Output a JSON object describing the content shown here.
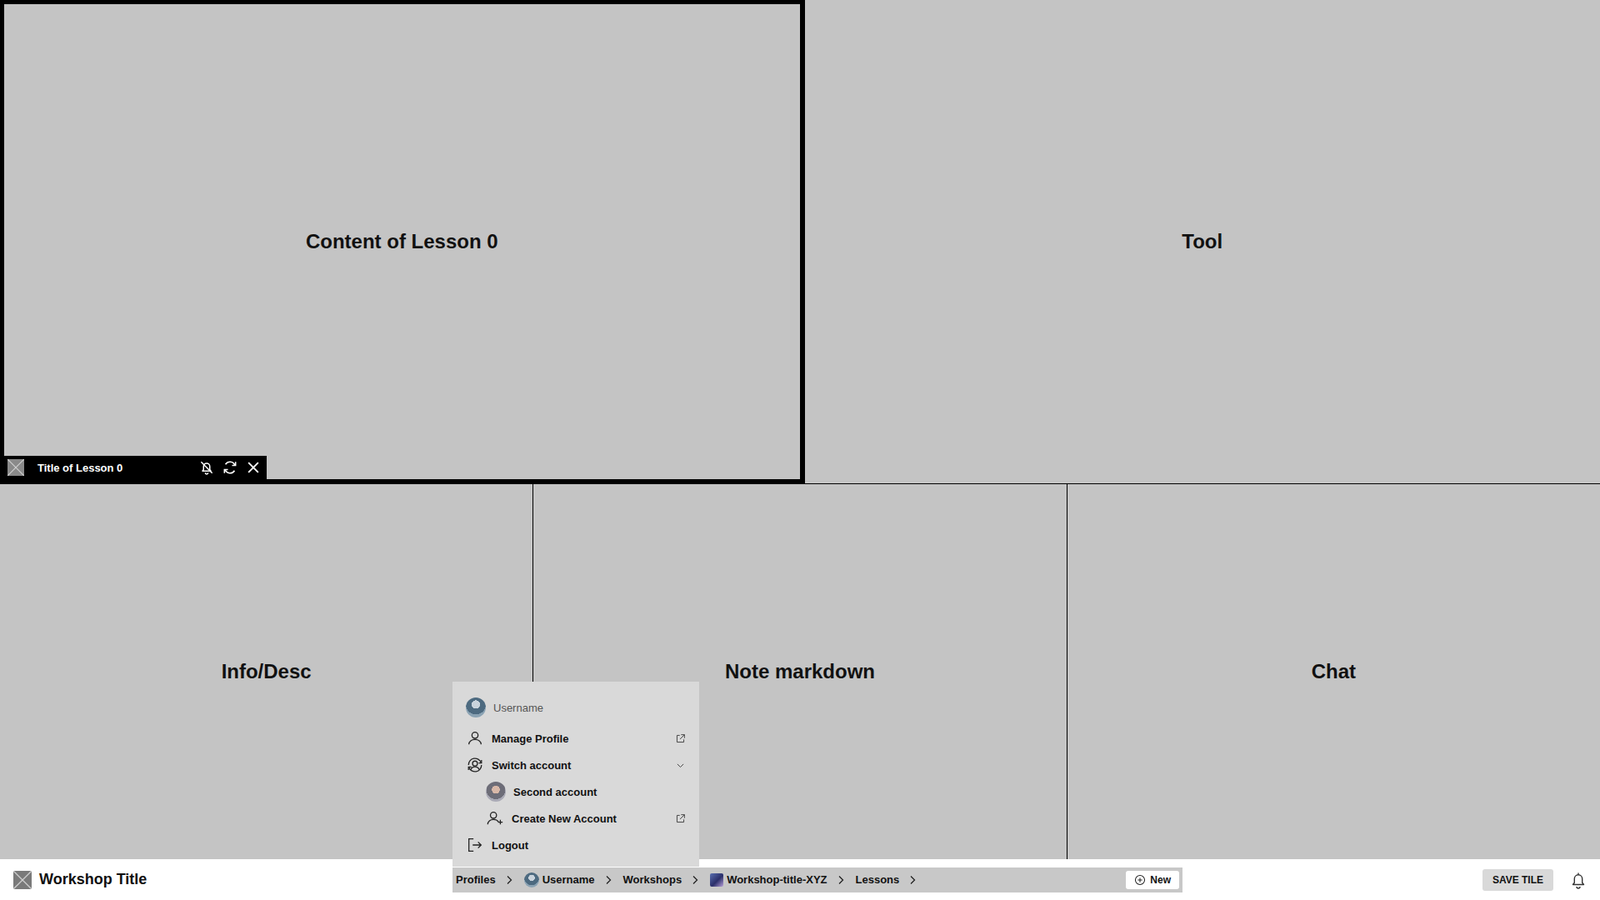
{
  "tile_rows": [
    {
      "tiles": [
        {
          "label": "Content of Lesson 0",
          "focused": true
        },
        {
          "label": "Tool",
          "focused": false
        }
      ]
    },
    {
      "tiles": [
        {
          "label": "Info/Desc",
          "focused": false
        },
        {
          "label": "Note markdown",
          "focused": false
        },
        {
          "label": "Chat",
          "focused": false
        }
      ]
    }
  ],
  "tile_bar": {
    "title": "Title of Lesson 0",
    "notifications_muted": true
  },
  "app_bar": {
    "title": "Workshop Title",
    "breadcrumbs": [
      {
        "label": "Profiles",
        "kind": "text"
      },
      {
        "label": "Username",
        "kind": "user"
      },
      {
        "label": "Workshops",
        "kind": "text"
      },
      {
        "label": "Workshop-title-XYZ",
        "kind": "workshop"
      },
      {
        "label": "Lessons",
        "kind": "text"
      }
    ],
    "new_button": "New",
    "save_button": "SAVE TILE"
  },
  "account_menu": {
    "header": "Username",
    "items": [
      {
        "label": "Manage Profile",
        "kind": "profile",
        "expanded": false,
        "children": []
      },
      {
        "label": "Switch account",
        "kind": "switch",
        "expanded": true,
        "children": [
          {
            "label": "Second account",
            "kind": "account"
          },
          {
            "label": "Create New Account",
            "kind": "create"
          }
        ]
      },
      {
        "label": "Logout",
        "kind": "logout",
        "expanded": false,
        "children": []
      }
    ]
  }
}
